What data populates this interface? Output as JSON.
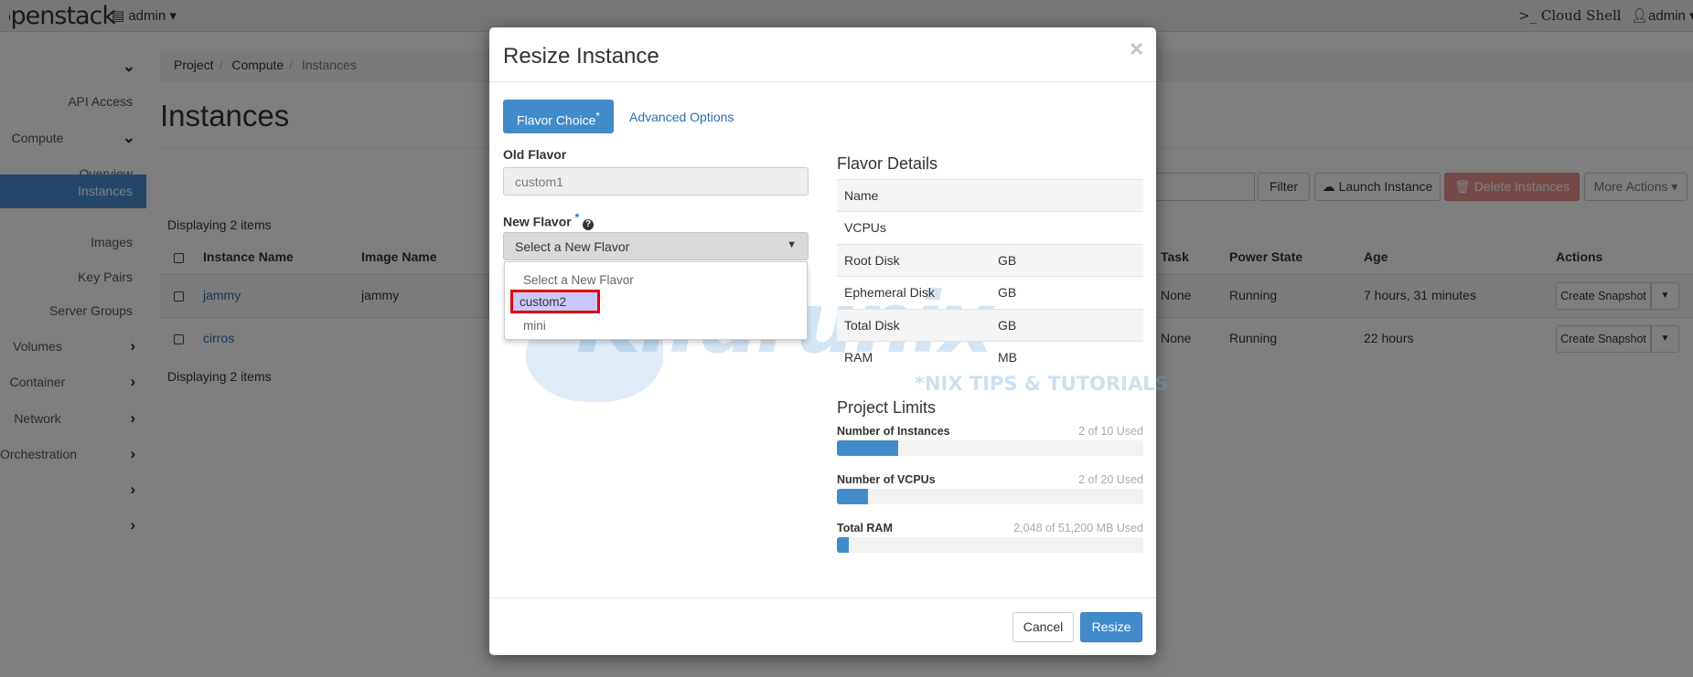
{
  "header": {
    "logo": "openstack",
    "project": "admin",
    "cloud_shell": ">_ Cloud Shell",
    "user": "admin"
  },
  "sidebar": {
    "items": [
      {
        "label": "",
        "type": "cat",
        "chev": "down"
      },
      {
        "label": "API Access",
        "type": "item"
      },
      {
        "label": "Compute",
        "type": "cat",
        "chev": "down"
      },
      {
        "label": "Overview",
        "type": "item"
      },
      {
        "label": "Instances",
        "type": "item",
        "active": true
      },
      {
        "label": "Images",
        "type": "item"
      },
      {
        "label": "Key Pairs",
        "type": "item"
      },
      {
        "label": "Server Groups",
        "type": "item"
      },
      {
        "label": "Volumes",
        "type": "cat",
        "chev": "right"
      },
      {
        "label": "Container",
        "type": "cat",
        "chev": "right"
      },
      {
        "label": "Network",
        "type": "cat",
        "chev": "right"
      },
      {
        "label": "Orchestration",
        "type": "cat",
        "chev": "right"
      },
      {
        "label": "",
        "type": "cat",
        "chev": "right"
      },
      {
        "label": "",
        "type": "cat",
        "chev": "right"
      }
    ]
  },
  "breadcrumb": [
    "Project",
    "Compute",
    "Instances"
  ],
  "page_title": "Instances",
  "toolbar": {
    "filter": "Filter",
    "launch": "Launch Instance",
    "delete": "Delete Instances",
    "more": "More Actions"
  },
  "table": {
    "count_text": "Displaying 2 items",
    "headers": [
      "Instance Name",
      "Image Name",
      "Task",
      "Power State",
      "Age",
      "Actions"
    ],
    "rows": [
      {
        "name": "jammy",
        "image": "jammy",
        "task": "None",
        "power": "Running",
        "age": "7 hours, 31 minutes",
        "action": "Create Snapshot"
      },
      {
        "name": "cirros",
        "image": "",
        "task": "None",
        "power": "Running",
        "age": "22 hours",
        "action": "Create Snapshot"
      }
    ]
  },
  "modal": {
    "title": "Resize Instance",
    "close": "×",
    "tabs": [
      {
        "label": "Flavor Choice",
        "required": "*",
        "active": true
      },
      {
        "label": "Advanced Options"
      }
    ],
    "old_flavor_label": "Old Flavor",
    "old_flavor_value": "custom1",
    "new_flavor_label": "New Flavor",
    "required_mark": "*",
    "new_flavor_selected": "Select a New Flavor",
    "new_flavor_options": [
      "Select a New Flavor",
      "custom2",
      "mini"
    ],
    "highlighted_option": "custom2",
    "flavor_details_title": "Flavor Details",
    "flavor_details": [
      {
        "label": "Name",
        "unit": ""
      },
      {
        "label": "VCPUs",
        "unit": ""
      },
      {
        "label": "Root Disk",
        "unit": "GB"
      },
      {
        "label": "Ephemeral Disk",
        "unit": "GB"
      },
      {
        "label": "Total Disk",
        "unit": "GB"
      },
      {
        "label": "RAM",
        "unit": "MB"
      }
    ],
    "project_limits_title": "Project Limits",
    "limits": [
      {
        "label": "Number of Instances",
        "text": "2 of 10 Used",
        "percent": 20
      },
      {
        "label": "Number of VCPUs",
        "text": "2 of 20 Used",
        "percent": 10
      },
      {
        "label": "Total RAM",
        "text": "2,048 of 51,200 MB Used",
        "percent": 4
      }
    ],
    "cancel": "Cancel",
    "submit": "Resize",
    "watermark": {
      "brand": "Kifarunix",
      "tagline": "*NIX TIPS & TUTORIALS"
    }
  },
  "colors": {
    "primary": "#428bca",
    "danger": "#d9534f",
    "highlight_box": "#e00000",
    "highlight_fill": "#c9c9ff"
  }
}
